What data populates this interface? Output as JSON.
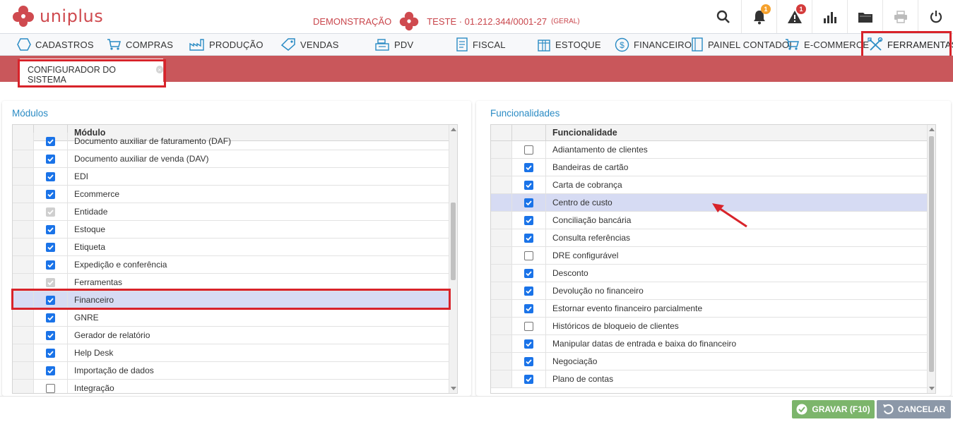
{
  "app": {
    "brand": "uniplus",
    "brand_color": "#cf4a4f"
  },
  "header": {
    "mode": "DEMONSTRAÇÃO",
    "company": "TESTE · 01.212.344/0001-27",
    "company_tag": "(GERAL)",
    "icons": [
      {
        "name": "search-icon"
      },
      {
        "name": "bell-icon",
        "badge": "1"
      },
      {
        "name": "alert-icon",
        "badge": "1"
      },
      {
        "name": "chart-icon"
      },
      {
        "name": "folder-icon"
      },
      {
        "name": "printer-icon"
      },
      {
        "name": "power-icon"
      }
    ]
  },
  "menu": {
    "items": [
      {
        "label": "CADASTROS",
        "icon": "hexagon-icon"
      },
      {
        "label": "COMPRAS",
        "icon": "cart-icon"
      },
      {
        "label": "PRODUÇÃO",
        "icon": "factory-icon"
      },
      {
        "label": "VENDAS",
        "icon": "tag-icon"
      },
      {
        "label": "PDV",
        "icon": "register-icon"
      },
      {
        "label": "FISCAL",
        "icon": "document-icon"
      },
      {
        "label": "ESTOQUE",
        "icon": "box-icon"
      },
      {
        "label": "FINANCEIRO",
        "icon": "dollar-icon"
      },
      {
        "label": "PAINEL CONTADOI",
        "icon": "ledger-icon"
      },
      {
        "label": "E-COMMERCE",
        "icon": "cart-icon"
      },
      {
        "label": "FERRAMENTAS",
        "icon": "tools-icon",
        "active": true
      }
    ]
  },
  "tab": {
    "label": "CONFIGURADOR DO SISTEMA",
    "close": "×"
  },
  "modulos": {
    "title": "Módulos",
    "column": "Módulo",
    "rows": [
      {
        "label": "Documento auxiliar de faturamento (DAF)",
        "state": "on"
      },
      {
        "label": "Documento auxiliar de venda (DAV)",
        "state": "on"
      },
      {
        "label": "EDI",
        "state": "on"
      },
      {
        "label": "Ecommerce",
        "state": "on"
      },
      {
        "label": "Entidade",
        "state": "dis"
      },
      {
        "label": "Estoque",
        "state": "on"
      },
      {
        "label": "Etiqueta",
        "state": "on"
      },
      {
        "label": "Expedição e conferência",
        "state": "on"
      },
      {
        "label": "Ferramentas",
        "state": "dis"
      },
      {
        "label": "Financeiro",
        "state": "on",
        "selected": true
      },
      {
        "label": "GNRE",
        "state": "on"
      },
      {
        "label": "Gerador de relatório",
        "state": "on"
      },
      {
        "label": "Help Desk",
        "state": "on"
      },
      {
        "label": "Importação de dados",
        "state": "on"
      },
      {
        "label": "Integração",
        "state": "off"
      }
    ]
  },
  "funcionalidades": {
    "title": "Funcionalidades",
    "column": "Funcionalidade",
    "rows": [
      {
        "label": "Adiantamento de clientes",
        "state": "off"
      },
      {
        "label": "Bandeiras de cartão",
        "state": "on"
      },
      {
        "label": "Carta de cobrança",
        "state": "on"
      },
      {
        "label": "Centro de custo",
        "state": "on",
        "selected": true
      },
      {
        "label": "Conciliação bancária",
        "state": "on"
      },
      {
        "label": "Consulta referências",
        "state": "on"
      },
      {
        "label": "DRE configurável",
        "state": "off"
      },
      {
        "label": "Desconto",
        "state": "on"
      },
      {
        "label": "Devolução no financeiro",
        "state": "on"
      },
      {
        "label": "Estornar evento financeiro parcialmente",
        "state": "on"
      },
      {
        "label": "Históricos de bloqueio de clientes",
        "state": "off"
      },
      {
        "label": "Manipular datas de entrada e baixa do financeiro",
        "state": "on"
      },
      {
        "label": "Negociação",
        "state": "on"
      },
      {
        "label": "Plano de contas",
        "state": "on"
      }
    ]
  },
  "footer": {
    "save": "GRAVAR (F10)",
    "cancel": "CANCELAR"
  },
  "colors": {
    "accent_red": "#c9575b",
    "highlight": "#d8232a",
    "checkbox": "#1a73e8",
    "title_blue": "#2a8bc4"
  }
}
